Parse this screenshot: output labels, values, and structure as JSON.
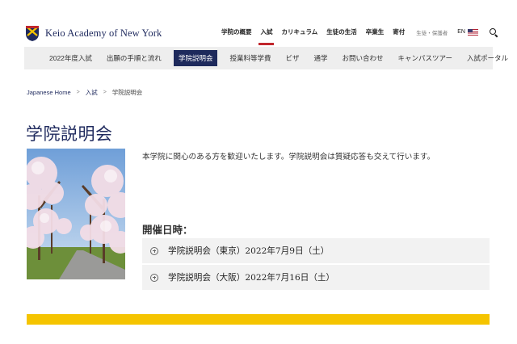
{
  "brand": {
    "name": "Keio Academy of New York"
  },
  "topnav": {
    "items": [
      {
        "label": "学院の概要"
      },
      {
        "label": "入試",
        "active": true
      },
      {
        "label": "カリキュラム"
      },
      {
        "label": "生徒の生活"
      },
      {
        "label": "卒業生"
      },
      {
        "label": "寄付"
      }
    ],
    "guardian": "生徒・保護者",
    "lang": "EN"
  },
  "subnav": {
    "items": [
      {
        "label": "2022年度入試"
      },
      {
        "label": "出願の手順と流れ"
      },
      {
        "label": "学院説明会",
        "active": true
      },
      {
        "label": "授業料等学費"
      },
      {
        "label": "ビザ"
      },
      {
        "label": "通学"
      },
      {
        "label": "お問い合わせ"
      },
      {
        "label": "キャンパスツアー"
      },
      {
        "label": "入試ポータル"
      }
    ]
  },
  "breadcrumb": {
    "home": "Japanese Home",
    "sep": ">",
    "parent": "入試",
    "current": "学院説明会"
  },
  "page": {
    "title": "学院説明会",
    "intro": "本学院に関心のある方を歓迎いたします。学院説明会は質疑応答も交えて行います。",
    "dates_heading": "開催日時：",
    "sessions": [
      {
        "label": "学院説明会（東京）2022年7月9日（土）"
      },
      {
        "label": "学院説明会（大阪）2022年7月16日（土）"
      }
    ]
  },
  "colors": {
    "navy": "#1e2a5c",
    "accent_red": "#c1272d",
    "yellow": "#f5c400"
  }
}
